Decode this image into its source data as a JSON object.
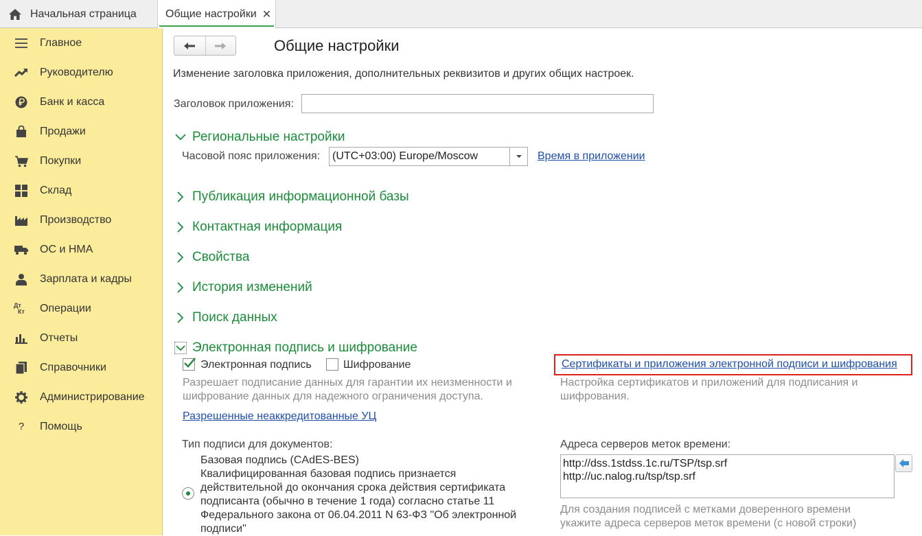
{
  "tabs": {
    "home": "Начальная страница",
    "active": "Общие настройки",
    "close": "✕"
  },
  "sidebar": {
    "items": [
      {
        "label": "Главное",
        "icon": "menu-lines-icon"
      },
      {
        "label": "Руководителю",
        "icon": "trend-chart-icon"
      },
      {
        "label": "Банк и касса",
        "icon": "ruble-icon"
      },
      {
        "label": "Продажи",
        "icon": "shopping-bag-icon"
      },
      {
        "label": "Покупки",
        "icon": "cart-icon"
      },
      {
        "label": "Склад",
        "icon": "warehouse-grid-icon"
      },
      {
        "label": "Производство",
        "icon": "factory-icon"
      },
      {
        "label": "ОС и НМА",
        "icon": "truck-icon"
      },
      {
        "label": "Зарплата и кадры",
        "icon": "person-icon"
      },
      {
        "label": "Операции",
        "icon": "dt-kt-icon"
      },
      {
        "label": "Отчеты",
        "icon": "bar-chart-icon"
      },
      {
        "label": "Справочники",
        "icon": "books-icon"
      },
      {
        "label": "Администрирование",
        "icon": "gear-icon"
      },
      {
        "label": "Помощь",
        "icon": "question-icon"
      }
    ],
    "dt": "Дт",
    "kt": "Кт",
    "question": "?"
  },
  "main": {
    "title": "Общие настройки",
    "description": "Изменение заголовка приложения, дополнительных реквизитов и других общих настроек.",
    "app_title_label": "Заголовок приложения:",
    "app_title_value": "",
    "regional": {
      "heading": "Региональные настройки",
      "timezone_label": "Часовой пояс приложения:",
      "timezone_value": "(UTC+03:00) Europe/Moscow",
      "time_link": "Время в приложении"
    },
    "sections": [
      "Публикация информационной базы",
      "Контактная информация",
      "Свойства",
      "История изменений",
      "Поиск данных"
    ],
    "esign": {
      "heading": "Электронная подпись и шифрование",
      "sign_label": "Электронная подпись",
      "sign_checked": true,
      "encrypt_label": "Шифрование",
      "encrypt_checked": false,
      "hint_line1": "Разрешает подписание данных для гарантии их неизменности и",
      "hint_line2": "шифрование данных для надежного ограничения доступа.",
      "ca_link": "Разрешенные неаккредитованные УЦ",
      "cert_link": "Сертификаты и приложения электронной подписи и шифрования",
      "cert_hint_line1": "Настройка сертификатов и приложений для подписания и",
      "cert_hint_line2": "шифрования.",
      "sig_type_label": "Тип подписи для документов:",
      "option_title": "Базовая подпись (CAdES-BES)",
      "option_lines": [
        "Квалифицированная базовая подпись признается",
        "действительной до окончания срока действия сертификата",
        "подписанта (обычно в течение 1 года) согласно статье 11",
        "Федерального закона от 06.04.2011 N 63-ФЗ \"Об электронной",
        "подписи\""
      ],
      "tsp_label": "Адреса серверов меток времени:",
      "tsp_value": "http://dss.1stdss.1c.ru/TSP/tsp.srf\nhttp://uc.nalog.ru/tsp/tsp.srf",
      "tsp_hint_line1": "Для создания подписей с метками доверенного времени",
      "tsp_hint_line2": "укажите адреса серверов меток времени (с новой строки)"
    }
  },
  "colors": {
    "sidebar_bg": "#fbec9b",
    "section_green": "#1a8c3a",
    "link_blue": "#1f4fa8",
    "highlight_red": "#e0201b"
  }
}
